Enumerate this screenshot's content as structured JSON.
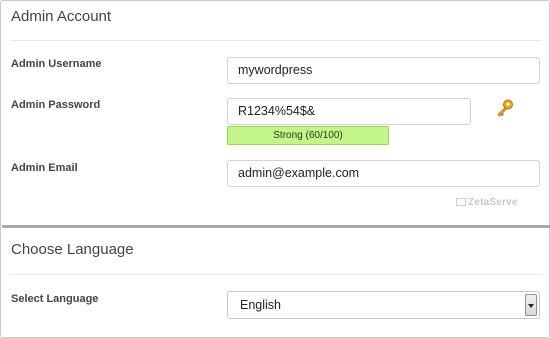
{
  "admin_account": {
    "title": "Admin Account",
    "username_label": "Admin Username",
    "username_value": "mywordpress",
    "password_label": "Admin Password",
    "password_value": "R1234%54$&",
    "strength_text": "Strong (60/100)",
    "email_label": "Admin Email",
    "email_value": "admin@example.com",
    "brand_text": "ZetaServe"
  },
  "language": {
    "title": "Choose Language",
    "select_label": "Select Language",
    "selected_value": "English"
  },
  "colors": {
    "strength_fill": "#c4f58a",
    "key_icon": "#d99a1e"
  },
  "icons": {
    "password_generator": "key-icon",
    "select_toggle": "chevron-down-icon"
  }
}
